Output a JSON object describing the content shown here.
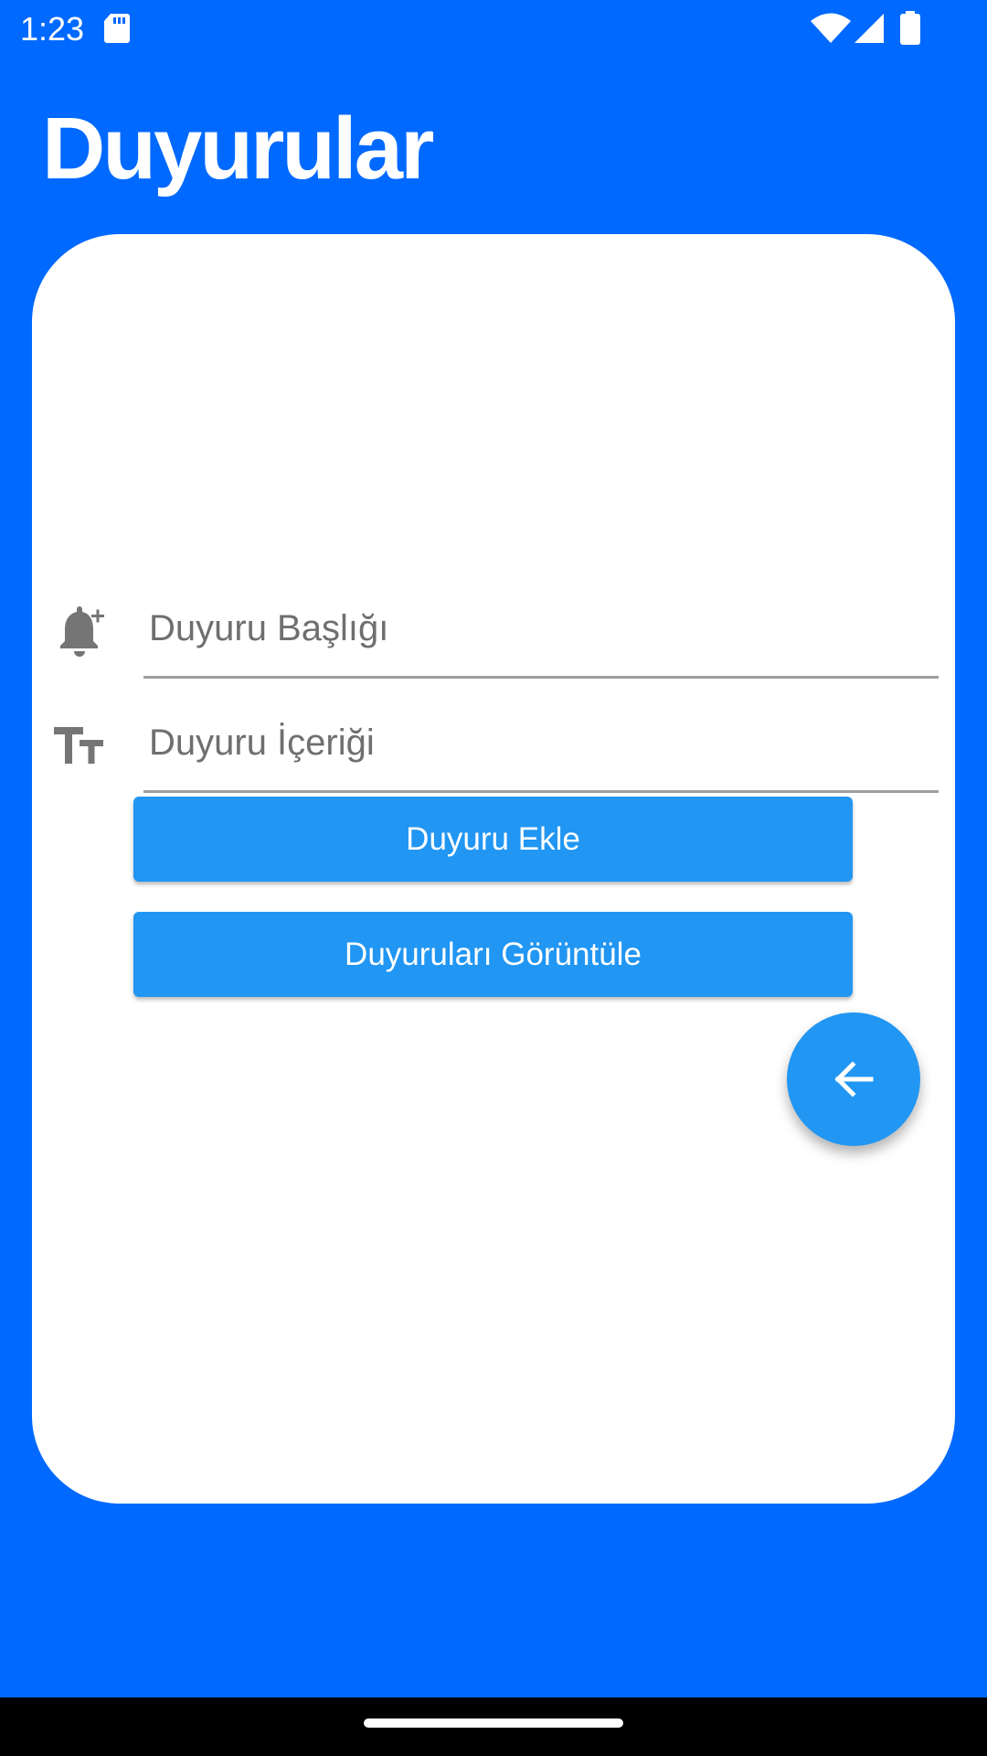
{
  "status_bar": {
    "time": "1:23",
    "icons": [
      "sd-card-icon",
      "wifi-icon",
      "signal-icon",
      "battery-icon"
    ]
  },
  "app": {
    "title": "Duyurular"
  },
  "form": {
    "title_field": {
      "placeholder": "Duyuru Başlığı",
      "value": "",
      "icon": "bell-plus-icon"
    },
    "content_field": {
      "placeholder": "Duyuru İçeriği",
      "value": "",
      "icon": "text-size-icon"
    },
    "add_button_label": "Duyuru Ekle",
    "view_button_label": "Duyuruları Görüntüle"
  },
  "fab": {
    "icon": "arrow-back-icon"
  },
  "colors": {
    "background": "#0069ff",
    "card": "#ffffff",
    "button": "#2196f3",
    "icon_gray": "#757575",
    "underline": "#9e9e9e",
    "nav_bar": "#000000"
  }
}
